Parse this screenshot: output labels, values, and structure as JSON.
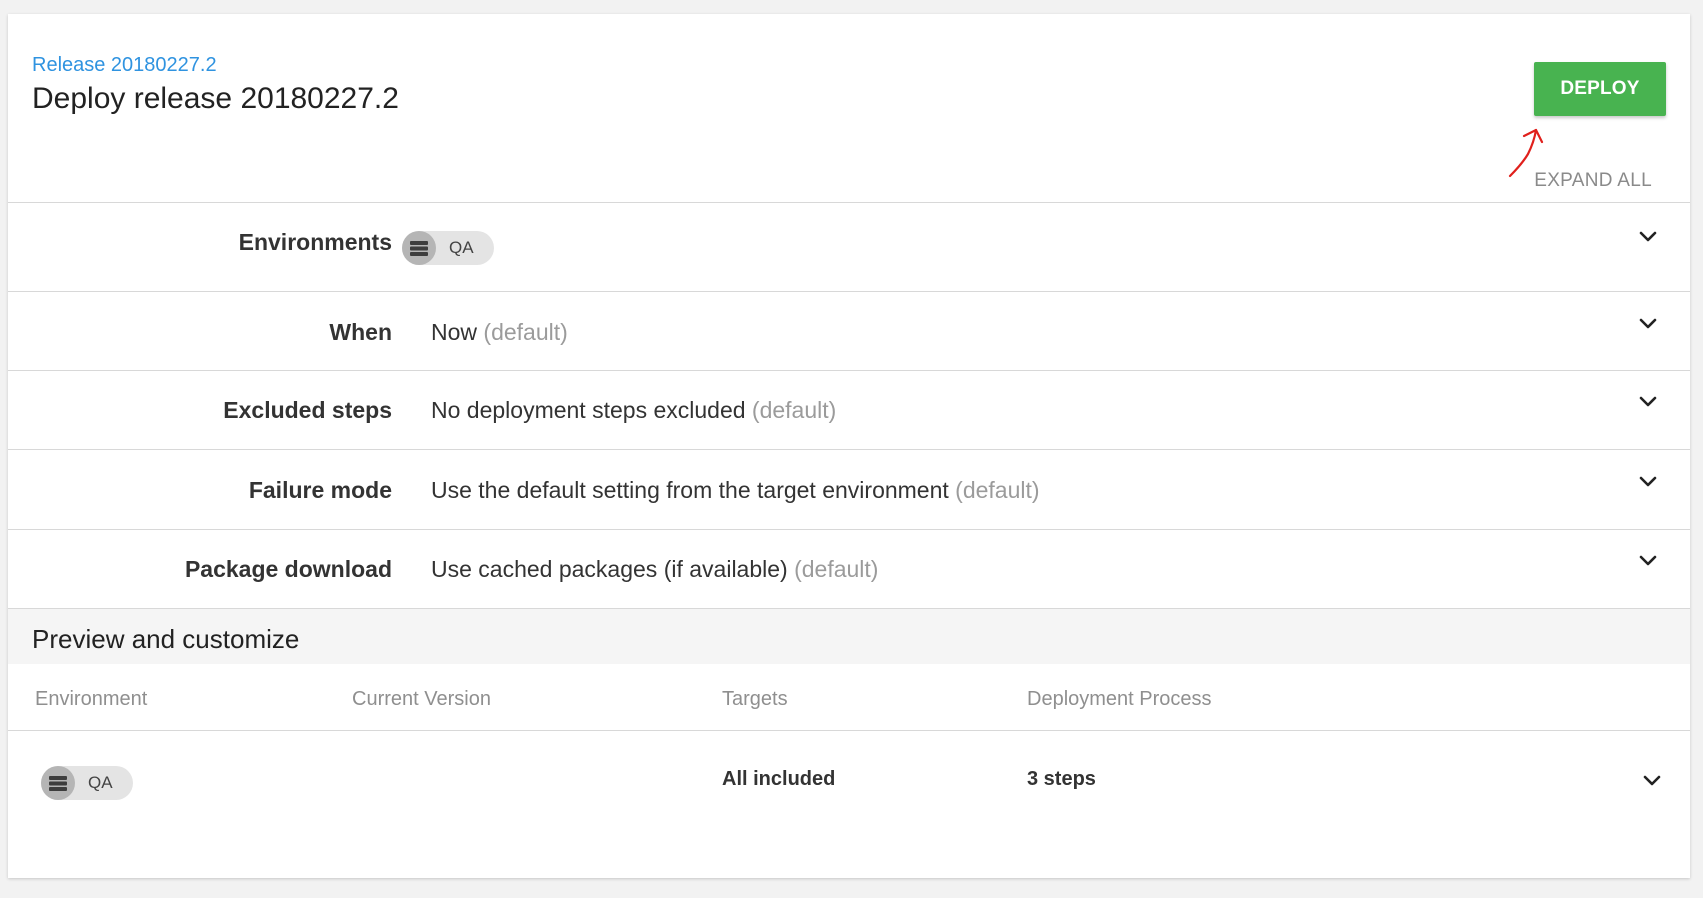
{
  "header": {
    "breadcrumb": "Release 20180227.2",
    "title": "Deploy release 20180227.2",
    "deploy_label": "DEPLOY",
    "expand_all_label": "EXPAND ALL"
  },
  "options": [
    {
      "key": "environments",
      "label": "Environments",
      "chip_icon": "server-icon",
      "chip_label": "QA"
    },
    {
      "key": "when",
      "label": "When",
      "value": "Now",
      "default": "(default)"
    },
    {
      "key": "excluded",
      "label": "Excluded steps",
      "value": "No deployment steps excluded",
      "default": "(default)"
    },
    {
      "key": "failure",
      "label": "Failure mode",
      "value": "Use the default setting from the target environment",
      "default": "(default)"
    },
    {
      "key": "package",
      "label": "Package download",
      "value": "Use cached packages (if available)",
      "default": "(default)"
    }
  ],
  "preview": {
    "title": "Preview and customize",
    "columns": [
      "Environment",
      "Current Version",
      "Targets",
      "Deployment Process"
    ],
    "rows": [
      {
        "environment": "QA",
        "environment_icon": "server-icon",
        "current_version": "",
        "targets": "All included",
        "process": "3 steps"
      }
    ]
  },
  "colors": {
    "deploy_button": "#48b350",
    "link": "#2f93e0",
    "annotation": "#e0201c",
    "muted_text": "#9b9b9b"
  }
}
